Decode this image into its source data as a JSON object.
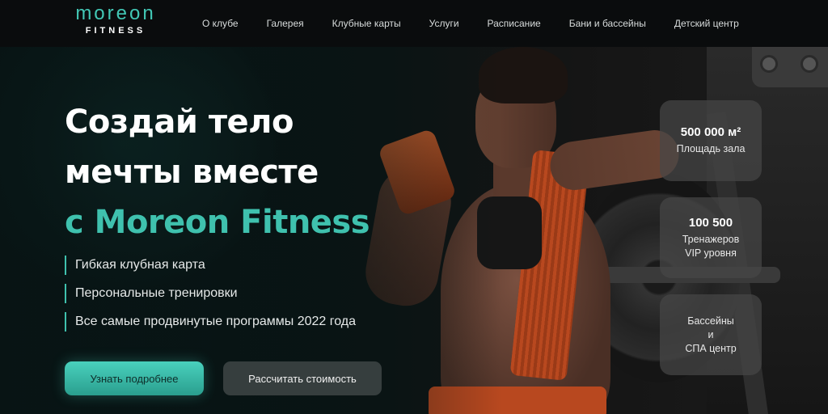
{
  "brand": {
    "name": "moreon",
    "sub": "FITNESS"
  },
  "nav": [
    "О клубе",
    "Галерея",
    "Клубные карты",
    "Услуги",
    "Расписание",
    "Бани и бассейны",
    "Детский центр"
  ],
  "hero": {
    "title_line1": "Создай тело",
    "title_line2": "мечты вместе",
    "title_line3": "с Moreon Fitness",
    "features": [
      "Гибкая клубная карта",
      "Персональные тренировки",
      "Все самые продвинутые программы 2022 года"
    ],
    "primary_button": "Узнать подробнее",
    "secondary_button": "Рассчитать стоимость"
  },
  "stats": [
    {
      "value": "500 000 м²",
      "label_lines": [
        "Площадь зала"
      ]
    },
    {
      "value": "100 500",
      "label_lines": [
        "Тренажеров",
        "VIP уровня"
      ]
    },
    {
      "value": "",
      "label_lines": [
        "Бассейны",
        "и",
        "СПА центр"
      ]
    }
  ],
  "colors": {
    "accent": "#3fc1ae",
    "header_bg": "#0a0c0d",
    "card_bg": "#464646"
  }
}
